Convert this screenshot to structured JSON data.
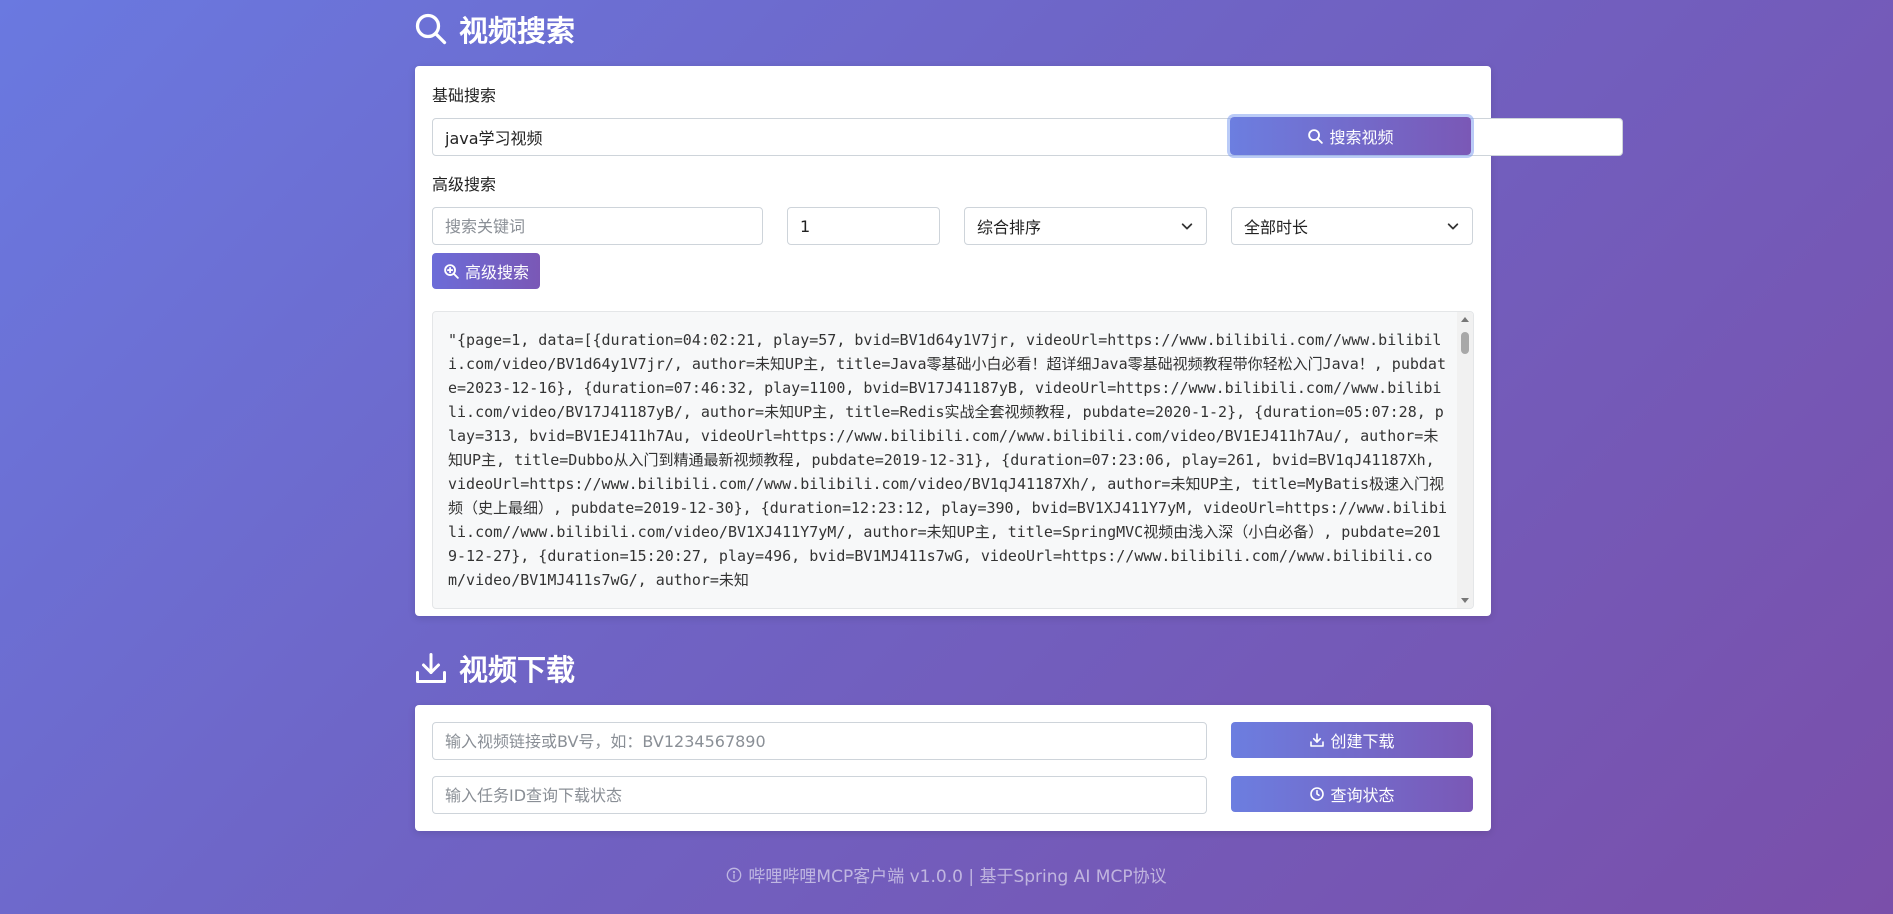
{
  "search_section": {
    "title": "视频搜索",
    "basic_label": "基础搜索",
    "basic_input_value": "java学习视频",
    "basic_button": "搜索视频",
    "advanced_label": "高级搜索",
    "keyword_placeholder": "搜索关键词",
    "page_value": "1",
    "sort_selected": "综合排序",
    "duration_selected": "全部时长",
    "advanced_button": "高级搜索",
    "result_text": "\"{page=1, data=[{duration=04:02:21, play=57, bvid=BV1d64y1V7jr, videoUrl=https://www.bilibili.com//www.bilibili.com/video/BV1d64y1V7jr/, author=未知UP主, title=Java零基础小白必看！超详细Java零基础视频教程带你轻松入门Java！, pubdate=2023-12-16}, {duration=07:46:32, play=1100, bvid=BV17J41187yB, videoUrl=https://www.bilibili.com//www.bilibili.com/video/BV17J41187yB/, author=未知UP主, title=Redis实战全套视频教程, pubdate=2020-1-2}, {duration=05:07:28, play=313, bvid=BV1EJ411h7Au, videoUrl=https://www.bilibili.com//www.bilibili.com/video/BV1EJ411h7Au/, author=未知UP主, title=Dubbo从入门到精通最新视频教程, pubdate=2019-12-31}, {duration=07:23:06, play=261, bvid=BV1qJ41187Xh, videoUrl=https://www.bilibili.com//www.bilibili.com/video/BV1qJ41187Xh/, author=未知UP主, title=MyBatis极速入门视频（史上最细）, pubdate=2019-12-30}, {duration=12:23:12, play=390, bvid=BV1XJ411Y7yM, videoUrl=https://www.bilibili.com//www.bilibili.com/video/BV1XJ411Y7yM/, author=未知UP主, title=SpringMVC视频由浅入深（小白必备）, pubdate=2019-12-27}, {duration=15:20:27, play=496, bvid=BV1MJ411s7wG, videoUrl=https://www.bilibili.com//www.bilibili.com/video/BV1MJ411s7wG/, author=未知"
  },
  "download_section": {
    "title": "视频下载",
    "url_placeholder": "输入视频链接或BV号，如：BV1234567890",
    "create_button": "创建下载",
    "task_placeholder": "输入任务ID查询下载状态",
    "status_button": "查询状态"
  },
  "footer": {
    "text": "哔哩哔哩MCP客户端 v1.0.0 | 基于Spring AI MCP协议"
  },
  "colors": {
    "accent_start": "#6c7ee0",
    "accent_end": "#7a58b6"
  }
}
